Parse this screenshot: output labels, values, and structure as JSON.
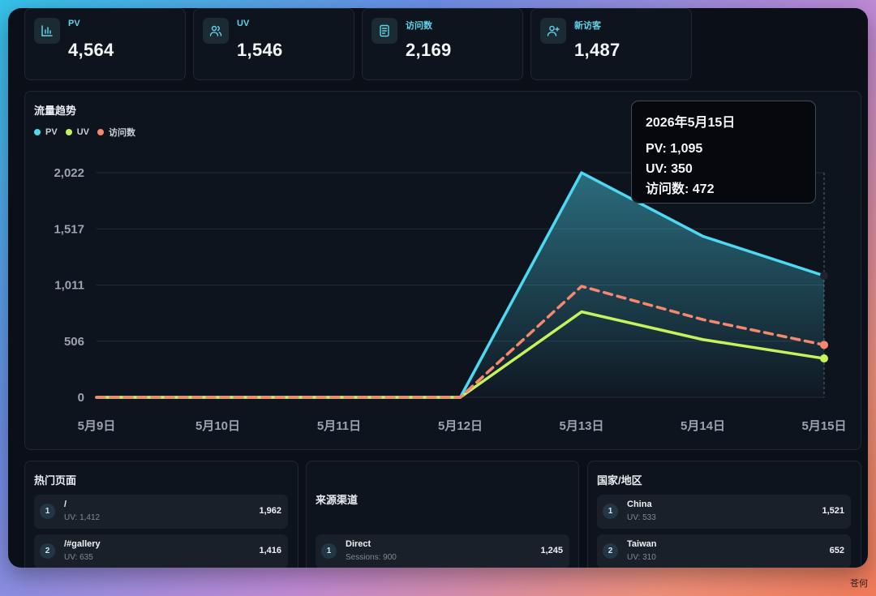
{
  "stats": [
    {
      "label": "PV",
      "value": "4,564",
      "icon": "bar-chart-icon"
    },
    {
      "label": "UV",
      "value": "1,546",
      "icon": "users-icon"
    },
    {
      "label": "访问数",
      "value": "2,169",
      "icon": "document-icon"
    },
    {
      "label": "新访客",
      "value": "1,487",
      "icon": "user-plus-icon"
    }
  ],
  "trend": {
    "title": "流量趋势",
    "legend": [
      {
        "name": "PV",
        "color": "#4dd9f2"
      },
      {
        "name": "UV",
        "color": "#c6f35c"
      },
      {
        "name": "访问数",
        "color": "#f7886e"
      }
    ],
    "tooltip": {
      "date": "2026年5月15日",
      "pv": "PV: 1,095",
      "uv": "UV: 350",
      "visits": "访问数: 472"
    }
  },
  "chart_data": {
    "type": "line",
    "title": "流量趋势",
    "categories": [
      "5月9日",
      "5月10日",
      "5月11日",
      "5月12日",
      "5月13日",
      "5月14日",
      "5月15日"
    ],
    "y_ticks": [
      "0",
      "506",
      "1,011",
      "1,517",
      "2,022"
    ],
    "ylim": [
      0,
      2022
    ],
    "grid": true,
    "legend_position": "top-left",
    "series": [
      {
        "name": "PV",
        "color": "#4dd9f2",
        "style": "solid",
        "area": true,
        "values": [
          0,
          0,
          0,
          0,
          2022,
          1450,
          1095
        ]
      },
      {
        "name": "UV",
        "color": "#c6f35c",
        "style": "solid",
        "values": [
          0,
          0,
          0,
          0,
          770,
          520,
          350
        ]
      },
      {
        "name": "访问数",
        "color": "#f7886e",
        "style": "dashed",
        "values": [
          0,
          0,
          0,
          0,
          1000,
          700,
          472
        ]
      }
    ]
  },
  "top_pages": {
    "title": "热门页面",
    "items": [
      {
        "rank": "1",
        "name": "/",
        "sub": "UV: 1,412",
        "value": "1,962"
      },
      {
        "rank": "2",
        "name": "/#gallery",
        "sub": "UV: 635",
        "value": "1,416"
      }
    ]
  },
  "sources": {
    "title": "来源渠道",
    "items": [
      {
        "rank": "1",
        "name": "Direct",
        "sub": "Sessions: 900",
        "value": "1,245"
      }
    ]
  },
  "countries": {
    "title": "国家/地区",
    "items": [
      {
        "rank": "1",
        "name": "China",
        "sub": "UV: 533",
        "value": "1,521"
      },
      {
        "rank": "2",
        "name": "Taiwan",
        "sub": "UV: 310",
        "value": "652"
      }
    ]
  },
  "watermark": "苍何"
}
